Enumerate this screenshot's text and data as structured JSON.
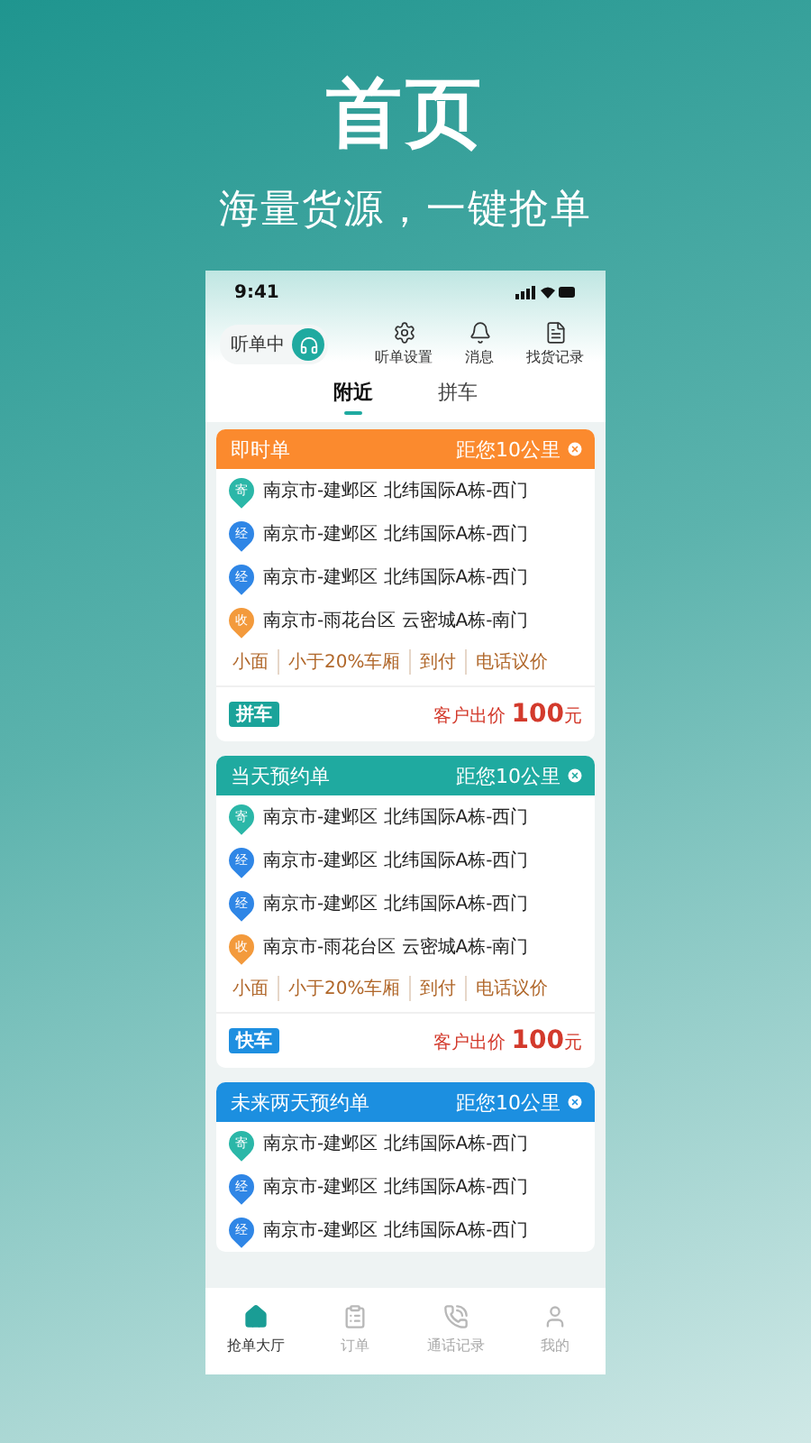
{
  "headline": "首页",
  "subheadline": "海量货源，一键抢单",
  "phone": {
    "status_bar": {
      "time": "9:41"
    },
    "header": {
      "listen_label": "听单中",
      "listen_on": true,
      "actions": [
        {
          "label": "听单设置",
          "kind": "settings"
        },
        {
          "label": "消息",
          "kind": "bell"
        },
        {
          "label": "找货记录",
          "kind": "record"
        }
      ]
    },
    "tabs": [
      {
        "label": "附近",
        "selected": true
      },
      {
        "label": "拼车",
        "selected": false
      }
    ],
    "orders": [
      {
        "title": "即时单",
        "distance": "距您10公里",
        "color": "#fb8a2e",
        "stops": [
          {
            "pin": "寄",
            "kind": "start",
            "address": "南京市-建邺区 北纬国际A栋-西门"
          },
          {
            "pin": "经",
            "kind": "via",
            "address": "南京市-建邺区 北纬国际A栋-西门"
          },
          {
            "pin": "经",
            "kind": "via",
            "address": "南京市-建邺区 北纬国际A栋-西门"
          },
          {
            "pin": "收",
            "kind": "end",
            "address": "南京市-雨花台区 云密城A栋-南门"
          }
        ],
        "tags": [
          "小面",
          "小于20%车厢",
          "到付",
          "电话议价"
        ],
        "ride_type": {
          "label": "拼车",
          "color": "#1aa39a"
        },
        "price_label": "客户出价",
        "price": "100",
        "price_unit": "元"
      },
      {
        "title": "当天预约单",
        "distance": "距您10公里",
        "color": "#1faaa0",
        "stops": [
          {
            "pin": "寄",
            "kind": "start",
            "address": "南京市-建邺区 北纬国际A栋-西门"
          },
          {
            "pin": "经",
            "kind": "via",
            "address": "南京市-建邺区 北纬国际A栋-西门"
          },
          {
            "pin": "经",
            "kind": "via",
            "address": "南京市-建邺区 北纬国际A栋-西门"
          },
          {
            "pin": "收",
            "kind": "end",
            "address": "南京市-雨花台区 云密城A栋-南门"
          }
        ],
        "tags": [
          "小面",
          "小于20%车厢",
          "到付",
          "电话议价"
        ],
        "ride_type": {
          "label": "快车",
          "color": "#1e8fe0"
        },
        "price_label": "客户出价",
        "price": "100",
        "price_unit": "元"
      },
      {
        "title": "未来两天预约单",
        "distance": "距您10公里",
        "color": "#1c8fe0",
        "stops": [
          {
            "pin": "寄",
            "kind": "start",
            "address": "南京市-建邺区 北纬国际A栋-西门"
          },
          {
            "pin": "经",
            "kind": "via",
            "address": "南京市-建邺区 北纬国际A栋-西门"
          },
          {
            "pin": "经",
            "kind": "via",
            "address": "南京市-建邺区 北纬国际A栋-西门"
          }
        ]
      }
    ],
    "bottom_nav": [
      {
        "label": "抢单大厅",
        "kind": "home",
        "selected": true
      },
      {
        "label": "订单",
        "kind": "orders",
        "selected": false
      },
      {
        "label": "通话记录",
        "kind": "calls",
        "selected": false
      },
      {
        "label": "我的",
        "kind": "me",
        "selected": false
      }
    ]
  }
}
